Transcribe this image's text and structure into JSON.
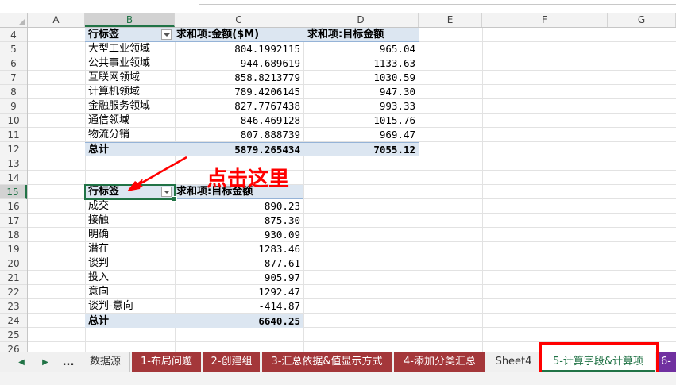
{
  "columns": [
    "A",
    "B",
    "C",
    "D",
    "E",
    "F",
    "G"
  ],
  "rows": [
    "4",
    "5",
    "6",
    "7",
    "8",
    "9",
    "10",
    "11",
    "12",
    "13",
    "14",
    "15",
    "16",
    "17",
    "18",
    "19",
    "20",
    "21",
    "22",
    "23",
    "24",
    "25",
    "26"
  ],
  "pivot1": {
    "header": {
      "row_label": "行标签",
      "col1": "求和项:金额($M)",
      "col2": "求和项:目标金额"
    },
    "rows": [
      {
        "label": "大型工业领域",
        "v1": "804.1992115",
        "v2": "965.04"
      },
      {
        "label": "公共事业领域",
        "v1": "944.689619",
        "v2": "1133.63"
      },
      {
        "label": "互联网领域",
        "v1": "858.8213779",
        "v2": "1030.59"
      },
      {
        "label": "计算机领域",
        "v1": "789.4206145",
        "v2": "947.30"
      },
      {
        "label": "金融服务领域",
        "v1": "827.7767438",
        "v2": "993.33"
      },
      {
        "label": "通信领域",
        "v1": "846.469128",
        "v2": "1015.76"
      },
      {
        "label": "物流分销",
        "v1": "807.888739",
        "v2": "969.47"
      }
    ],
    "total": {
      "label": "总计",
      "v1": "5879.265434",
      "v2": "7055.12"
    }
  },
  "pivot2": {
    "header": {
      "row_label": "行标签",
      "col1": "求和项:目标金额"
    },
    "rows": [
      {
        "label": "成交",
        "v1": "890.23"
      },
      {
        "label": "接触",
        "v1": "875.30"
      },
      {
        "label": "明确",
        "v1": "930.09"
      },
      {
        "label": "潜在",
        "v1": "1283.46"
      },
      {
        "label": "谈判",
        "v1": "877.61"
      },
      {
        "label": "投入",
        "v1": "905.97"
      },
      {
        "label": "意向",
        "v1": "1292.47"
      },
      {
        "label": "谈判-意向",
        "v1": "-414.87"
      }
    ],
    "total": {
      "label": "总计",
      "v1": "6640.25"
    }
  },
  "annotation": {
    "text": "点击这里",
    "color": "#ff0000"
  },
  "sheet_tabs": {
    "more": "...",
    "tabs": [
      "数据源",
      "1-布局问题",
      "2-创建组",
      "3-汇总依据&值显示方式",
      "4-添加分类汇总",
      "Sheet4",
      "5-计算字段&计算项",
      "6-"
    ]
  },
  "colors": {
    "accent": "#217346",
    "tab_red": "#a4373a",
    "tab_purple": "#7030a0",
    "pivot_header": "#dce6f1"
  }
}
